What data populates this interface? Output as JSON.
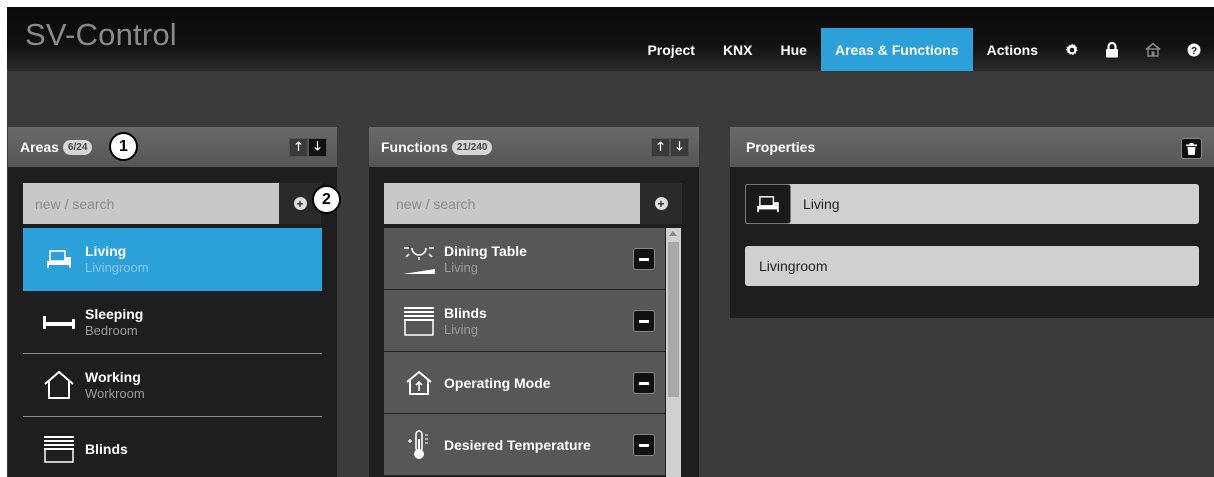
{
  "app": {
    "title": "SV-Control"
  },
  "nav": {
    "items": [
      {
        "label": "Project"
      },
      {
        "label": "KNX"
      },
      {
        "label": "Hue"
      },
      {
        "label": "Areas & Functions"
      },
      {
        "label": "Actions"
      }
    ],
    "icons": [
      "gear-icon",
      "lock-icon",
      "home-icon",
      "help-icon"
    ],
    "active": "Areas & Functions",
    "accent": "#2ca0d8"
  },
  "areas_panel": {
    "title": "Areas",
    "count": "6/24",
    "callout": "1",
    "search_placeholder": "new / search",
    "add_callout": "2",
    "items": [
      {
        "name": "Living",
        "sub": "Livingroom",
        "icon": "sofa-icon",
        "active": true
      },
      {
        "name": "Sleeping",
        "sub": "Bedroom",
        "icon": "bed-icon",
        "active": false
      },
      {
        "name": "Working",
        "sub": "Workroom",
        "icon": "house-icon",
        "active": false
      },
      {
        "name": "Blinds",
        "sub": "",
        "icon": "blinds-icon",
        "active": false
      }
    ]
  },
  "functions_panel": {
    "title": "Functions",
    "count": "21/240",
    "search_placeholder": "new / search",
    "items": [
      {
        "name": "Dining Table",
        "sub": "Living",
        "icon": "dimmer-light-icon"
      },
      {
        "name": "Blinds",
        "sub": "Living",
        "icon": "blinds-icon"
      },
      {
        "name": "Operating Mode",
        "sub": "",
        "icon": "house-mode-icon"
      },
      {
        "name": "Desiered Temperature",
        "sub": "",
        "icon": "thermometer-icon"
      }
    ]
  },
  "properties_panel": {
    "title": "Properties",
    "name_value": "Living",
    "room_value": "Livingroom"
  }
}
